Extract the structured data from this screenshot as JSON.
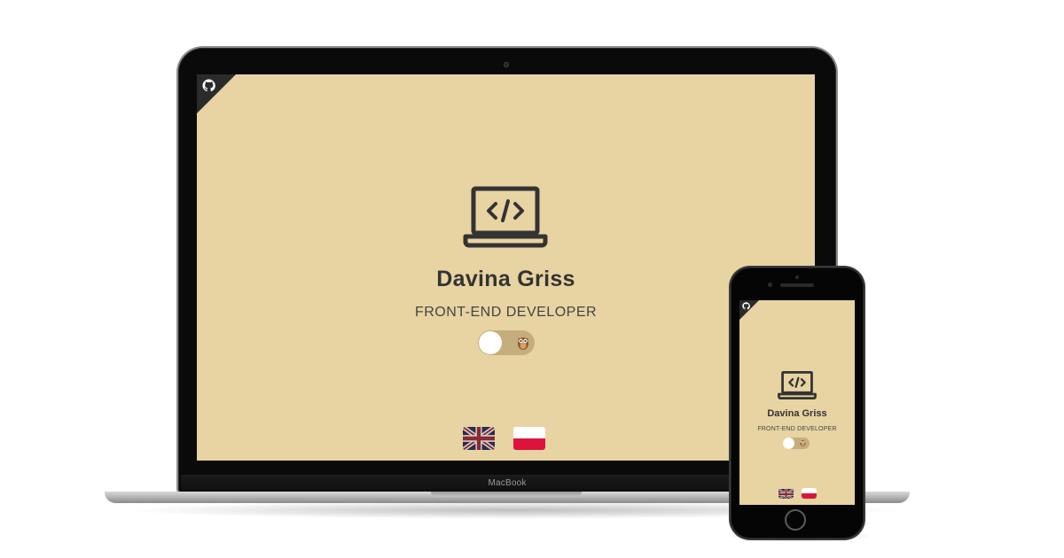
{
  "laptop": {
    "brand_label": "MacBook",
    "screen": {
      "corner_icon": "github-octocat-icon",
      "hero_icon": "laptop-code-icon",
      "name": "Davina Griss",
      "role": "FRONT-END DEVELOPER",
      "theme_toggle": {
        "icon": "owl-icon",
        "state": "off"
      },
      "languages": [
        {
          "code": "en",
          "flag": "uk-flag-icon"
        },
        {
          "code": "pl",
          "flag": "poland-flag-icon"
        }
      ]
    }
  },
  "phone": {
    "screen": {
      "corner_icon": "github-octocat-icon",
      "hero_icon": "laptop-code-icon",
      "name": "Davina Griss",
      "role": "FRONT-END DEVELOPER",
      "theme_toggle": {
        "icon": "owl-icon",
        "state": "off"
      },
      "languages": [
        {
          "code": "en",
          "flag": "uk-flag-icon"
        },
        {
          "code": "pl",
          "flag": "poland-flag-icon"
        }
      ]
    }
  },
  "colors": {
    "page_background": "#e8d4a2",
    "text_dark": "#333333",
    "toggle_track": "#c6ae7c",
    "corner_ribbon": "#2b2b2b",
    "poland_red": "#dc143c"
  }
}
